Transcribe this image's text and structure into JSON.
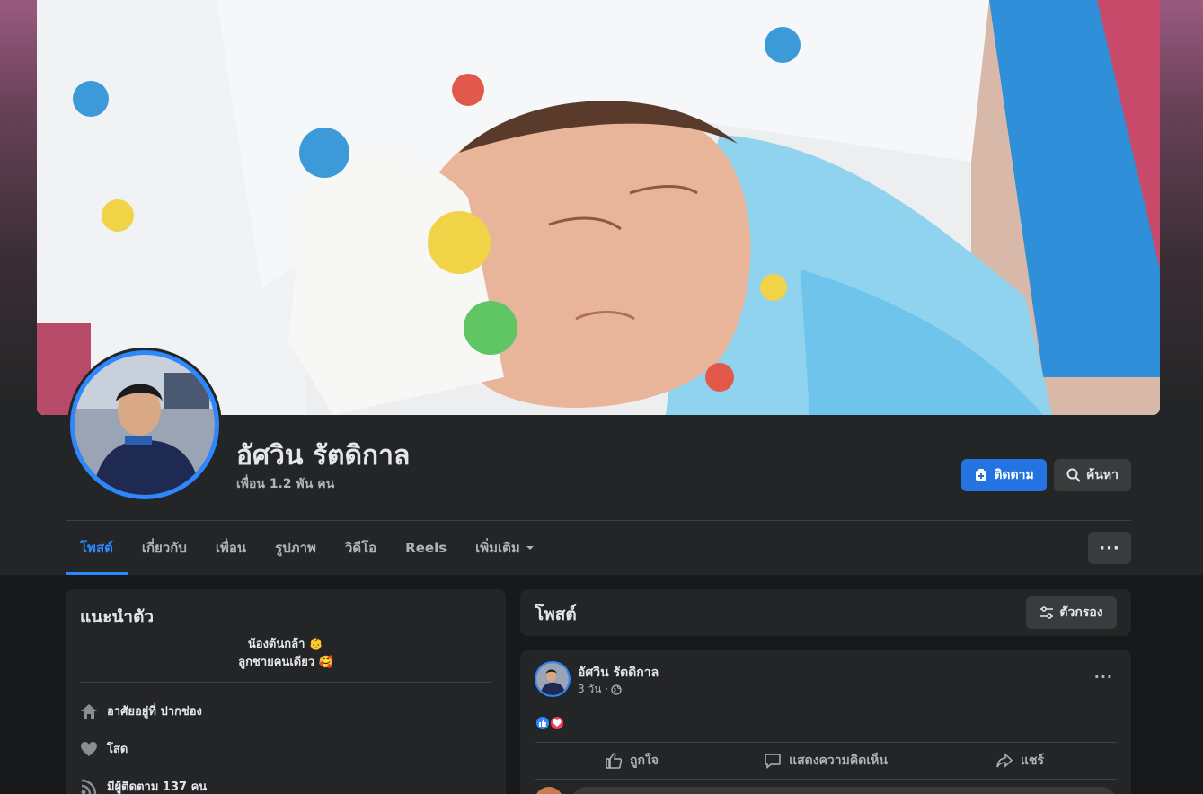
{
  "profile": {
    "name": "อัศวิน รัตดิกาล",
    "friends": "เพื่อน 1.2 พัน คน",
    "follow_label": "ติดตาม",
    "search_label": "ค้นหา",
    "accent_color": "#2d88ff"
  },
  "tabs": [
    {
      "label": "โพสต์",
      "active": true
    },
    {
      "label": "เกี่ยวกับ"
    },
    {
      "label": "เพื่อน"
    },
    {
      "label": "รูปภาพ"
    },
    {
      "label": "วิดีโอ"
    },
    {
      "label": "Reels"
    },
    {
      "label": "เพิ่มเติม"
    }
  ],
  "more_button": "···",
  "intro": {
    "title": "แนะนำตัว",
    "bio_line1": "น้องต้นกล้า 👶",
    "bio_line2": "ลูกชายคนเดียว 🥰",
    "items": [
      {
        "icon": "home-icon",
        "label": "อาศัยอยู่ที่ ปากช่อง"
      },
      {
        "icon": "heart-icon",
        "label": "โสด"
      },
      {
        "icon": "rss-icon",
        "label": "มีผู้ติดตาม 137 คน"
      }
    ]
  },
  "posts": {
    "title": "โพสต์",
    "filter_label": "ตัวกรอง",
    "post": {
      "author": "อัศวิน รัตดิกาล",
      "time": "3 วัน ·",
      "more": "···",
      "actions": {
        "like": "ถูกใจ",
        "comment": "แสดงความคิดเห็น",
        "share": "แชร์"
      }
    }
  }
}
